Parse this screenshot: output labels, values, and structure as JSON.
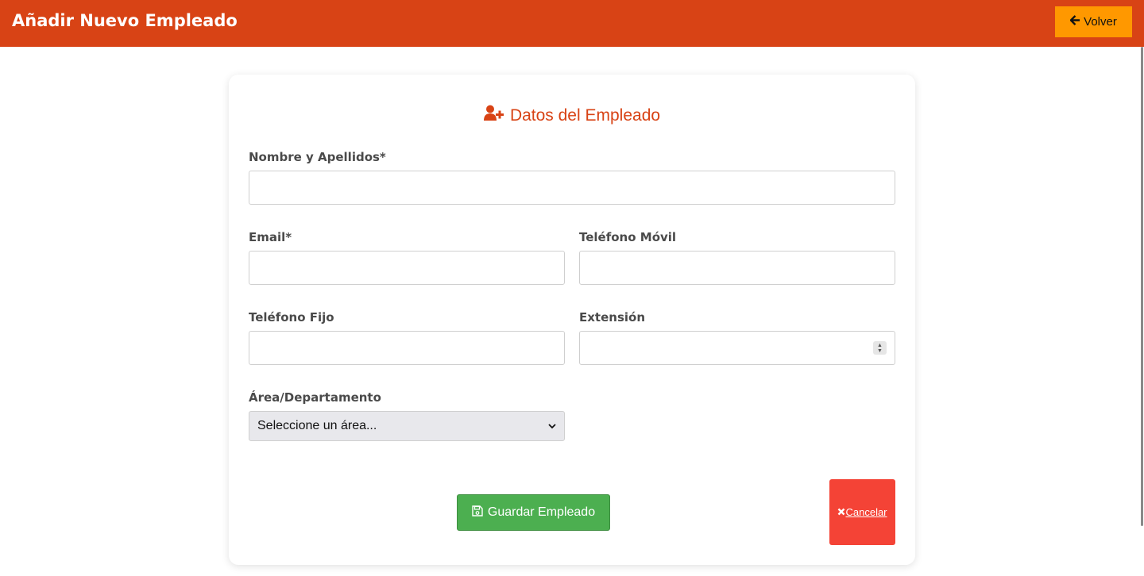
{
  "header": {
    "title": "Añadir Nuevo Empleado",
    "back_label": "Volver"
  },
  "form": {
    "section_title": "Datos del Empleado",
    "fields": {
      "nombre": {
        "label": "Nombre y Apellidos*",
        "value": ""
      },
      "email": {
        "label": "Email*",
        "value": ""
      },
      "movil": {
        "label": "Teléfono Móvil",
        "value": ""
      },
      "fijo": {
        "label": "Teléfono Fijo",
        "value": ""
      },
      "extension": {
        "label": "Extensión",
        "value": ""
      },
      "area": {
        "label": "Área/Departamento",
        "selected": "Seleccione un área..."
      }
    },
    "save_label": "Guardar Empleado",
    "cancel_label": "Cancelar"
  },
  "colors": {
    "header_bg": "#d84315",
    "back_button_bg": "#ff9800",
    "accent": "#d84315",
    "save_bg": "#4caf50",
    "cancel_bg": "#f44336"
  },
  "icons": {
    "back": "arrow-left-icon",
    "section": "user-plus-icon",
    "save": "floppy-disk-icon",
    "cancel": "x-icon",
    "select": "chevron-down-icon"
  }
}
